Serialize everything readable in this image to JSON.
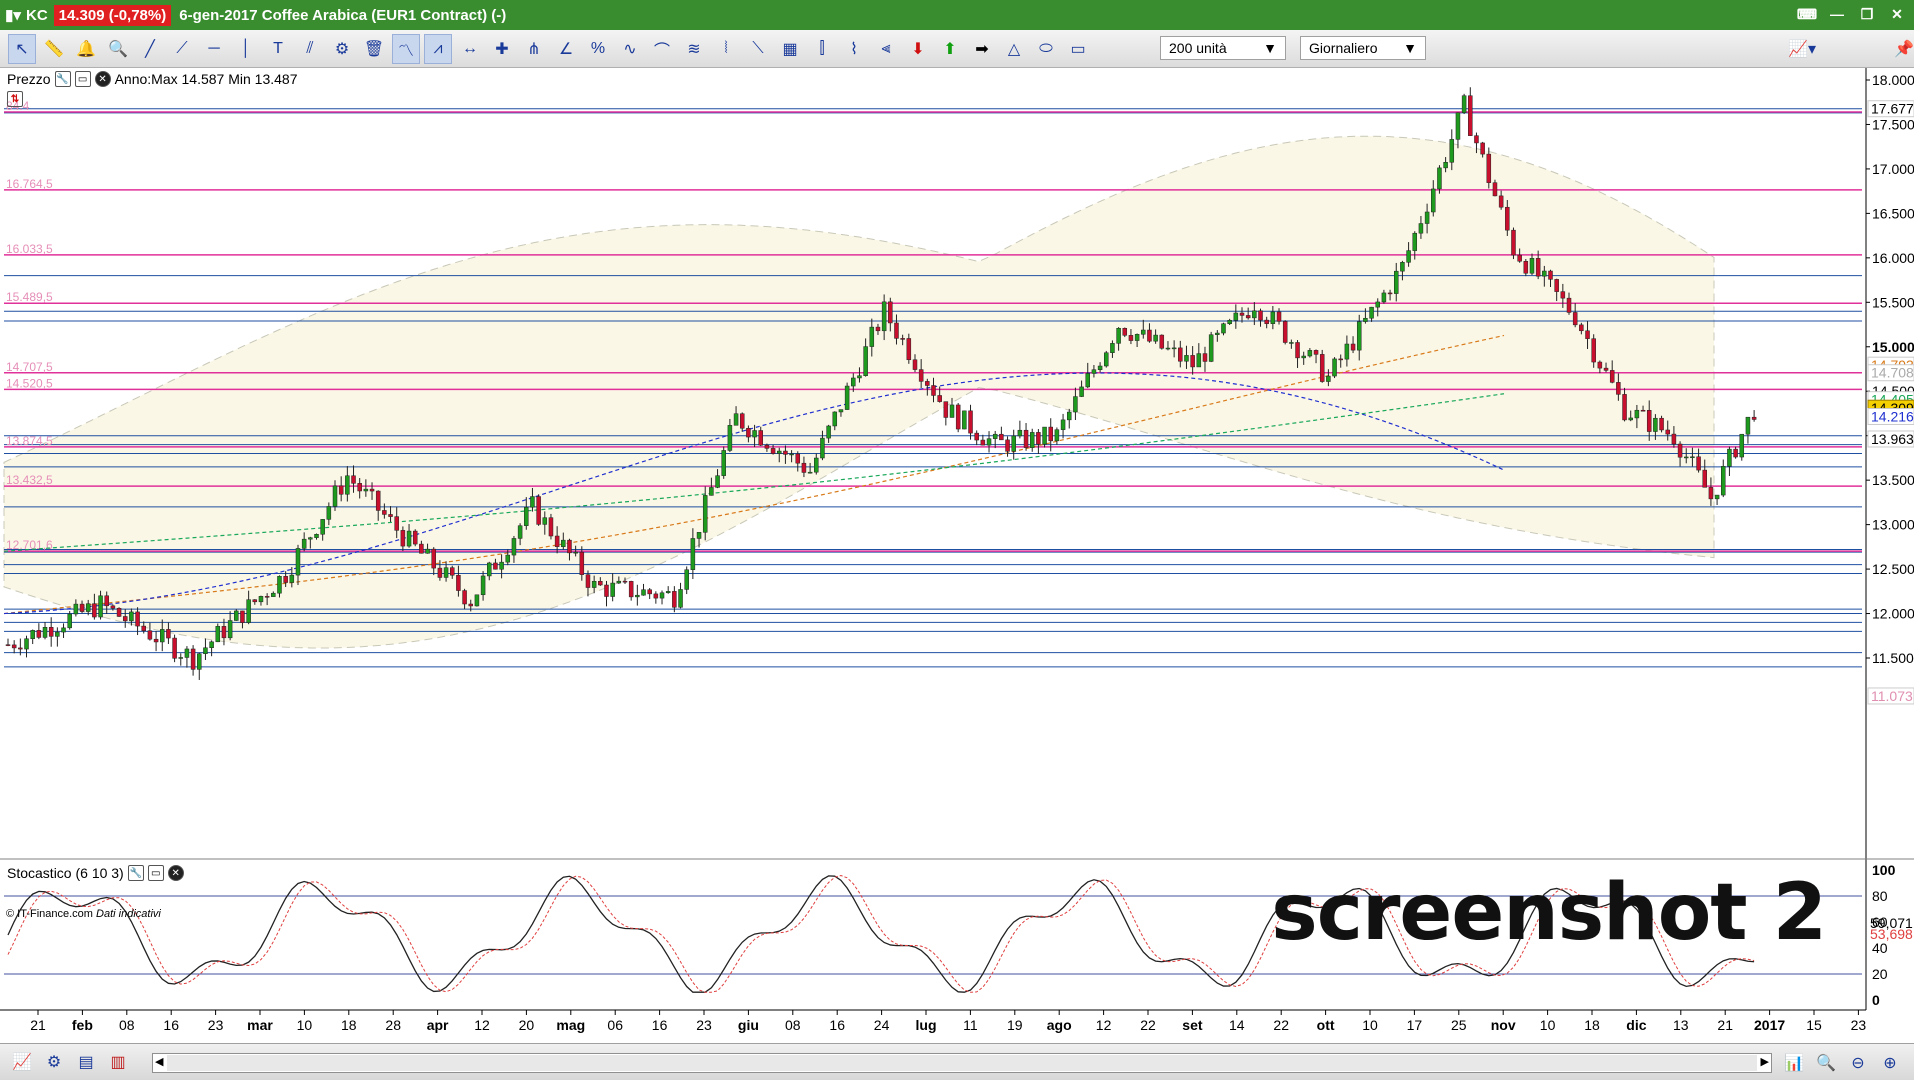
{
  "titlebar": {
    "symbol": "KC",
    "price_change": "14.309 (-0,78%)",
    "title": "6-gen-2017 Coffee Arabica (EUR1 Contract) (-)"
  },
  "toolbar": {
    "units_select": "200 unità",
    "period_select": "Giornaliero"
  },
  "price_pane": {
    "label": "Prezzo",
    "range_info": "Anno:Max 14.587 Min 13.487",
    "copyright": "© IT-Finance.com",
    "copyright_note": "Dati indicativi",
    "watermark": "screenshot 2",
    "yaxis_ticks": [
      "18.000",
      "17.500",
      "17.000",
      "16.500",
      "16.000",
      "15.500",
      "15.000",
      "14.500",
      "14.000",
      "13.500",
      "13.000",
      "12.500",
      "12.000",
      "11.500"
    ],
    "price_labels": [
      {
        "text": "17.677",
        "bg": "#ffffff",
        "fg": "#000000"
      },
      {
        "text": "14.793",
        "bg": "#ffffff",
        "fg": "#d87a1a"
      },
      {
        "text": "14.708",
        "bg": "#ffffff",
        "fg": "#aaaaaa"
      },
      {
        "text": "14.405",
        "bg": "#ffffff",
        "fg": "#19a85a"
      },
      {
        "text": "14.309",
        "bg": "#f5d000",
        "fg": "#000000"
      },
      {
        "text": "14.216",
        "bg": "#ffffff",
        "fg": "#2030d0"
      },
      {
        "text": "13.963",
        "bg": "#ffffff",
        "fg": "#000000"
      },
      {
        "text": "11.073",
        "bg": "#ffffff",
        "fg": "#e08fb0"
      }
    ],
    "fib_labels": [
      "84.4",
      "16.764,5",
      "16.033,5",
      "15.489,5",
      "14.707,5",
      "14.520,5",
      "13.874,5",
      "13.432,5",
      "12.701,6"
    ]
  },
  "stoch_pane": {
    "label": "Stocastico (6 10 3)",
    "yaxis_ticks": [
      "100",
      "80",
      "60",
      "40",
      "20",
      "0"
    ],
    "value_labels": [
      {
        "text": "59,071",
        "fg": "#000000"
      },
      {
        "text": "53,698",
        "fg": "#e04040"
      }
    ]
  },
  "xaxis_labels": [
    {
      "t": "21",
      "b": false
    },
    {
      "t": "feb",
      "b": true
    },
    {
      "t": "08",
      "b": false
    },
    {
      "t": "16",
      "b": false
    },
    {
      "t": "23",
      "b": false
    },
    {
      "t": "mar",
      "b": true
    },
    {
      "t": "10",
      "b": false
    },
    {
      "t": "18",
      "b": false
    },
    {
      "t": "28",
      "b": false
    },
    {
      "t": "apr",
      "b": true
    },
    {
      "t": "12",
      "b": false
    },
    {
      "t": "20",
      "b": false
    },
    {
      "t": "mag",
      "b": true
    },
    {
      "t": "06",
      "b": false
    },
    {
      "t": "16",
      "b": false
    },
    {
      "t": "23",
      "b": false
    },
    {
      "t": "giu",
      "b": true
    },
    {
      "t": "08",
      "b": false
    },
    {
      "t": "16",
      "b": false
    },
    {
      "t": "24",
      "b": false
    },
    {
      "t": "lug",
      "b": true
    },
    {
      "t": "11",
      "b": false
    },
    {
      "t": "19",
      "b": false
    },
    {
      "t": "ago",
      "b": true
    },
    {
      "t": "12",
      "b": false
    },
    {
      "t": "22",
      "b": false
    },
    {
      "t": "set",
      "b": true
    },
    {
      "t": "14",
      "b": false
    },
    {
      "t": "22",
      "b": false
    },
    {
      "t": "ott",
      "b": true
    },
    {
      "t": "10",
      "b": false
    },
    {
      "t": "17",
      "b": false
    },
    {
      "t": "25",
      "b": false
    },
    {
      "t": "nov",
      "b": true
    },
    {
      "t": "10",
      "b": false
    },
    {
      "t": "18",
      "b": false
    },
    {
      "t": "dic",
      "b": true
    },
    {
      "t": "13",
      "b": false
    },
    {
      "t": "21",
      "b": false
    },
    {
      "t": "2017",
      "b": true
    },
    {
      "t": "15",
      "b": false
    },
    {
      "t": "23",
      "b": false
    }
  ],
  "colors": {
    "up_candle": "#1e9a1e",
    "down_candle": "#c8102e",
    "bollinger_fill": "#fbf7e6",
    "fib_line": "#e0309a",
    "hline_blue": "#1f4fa0",
    "ma_blue": "#2030d0",
    "ma_orange": "#d87a1a",
    "ma_green": "#19a85a"
  },
  "icons": [
    "pointer-icon",
    "ruler-icon",
    "bell-icon",
    "zoom-icon",
    "trendline-icon",
    "channel-icon",
    "hline-icon",
    "vline-icon",
    "text-icon",
    "fib-icon",
    "settings-icon",
    "trash-icon",
    "arrow-down-icon",
    "arrow-up-icon",
    "arrow-right-icon",
    "triangle-icon",
    "ellipse-icon",
    "rectangle-icon"
  ]
}
